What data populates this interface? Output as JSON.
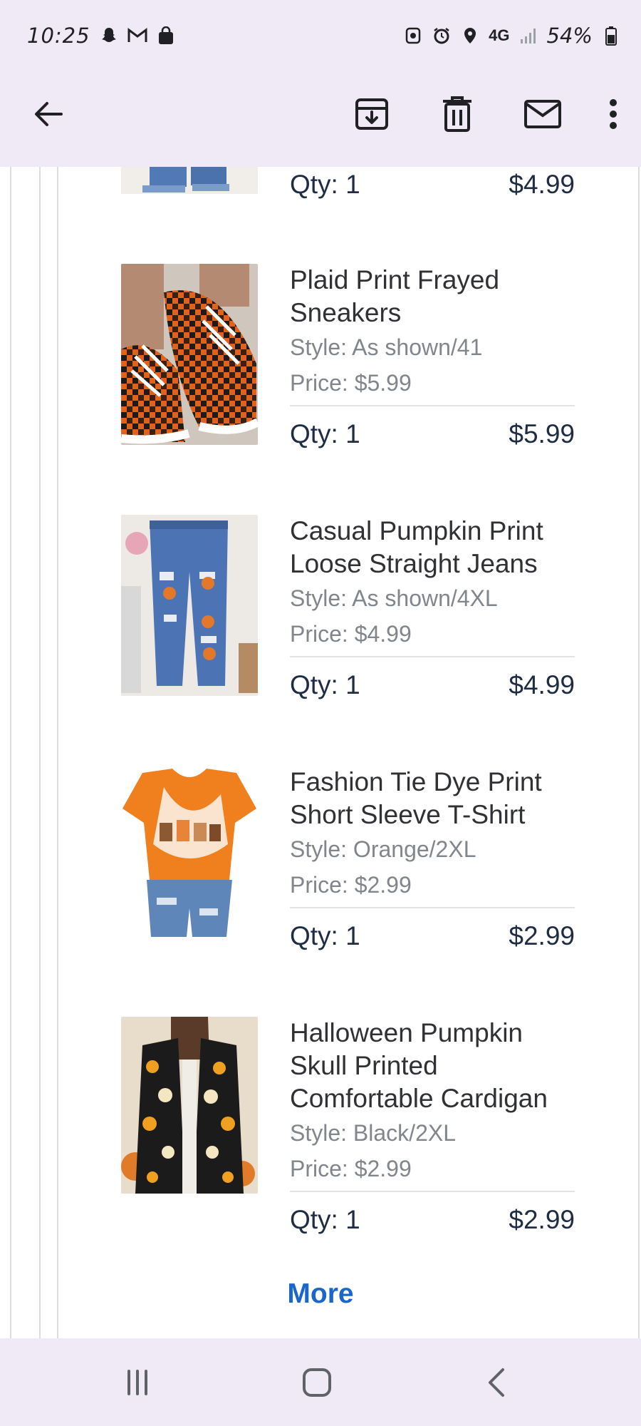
{
  "status_bar": {
    "time": "10:25",
    "network": "4G",
    "battery": "54%",
    "left_icons": [
      "snapchat-icon",
      "gmail-icon",
      "shopping-bag-icon"
    ],
    "right_icons": [
      "nfc-icon",
      "alarm-icon",
      "location-icon",
      "signal-icon",
      "battery-icon"
    ]
  },
  "app_bar": {
    "icons": [
      "back-arrow-icon",
      "archive-icon",
      "delete-icon",
      "mark-unread-icon",
      "more-vert-icon"
    ]
  },
  "items": [
    {
      "title": "",
      "style": "",
      "price": "",
      "qty": "Qty: 1",
      "total": "$4.99",
      "image": "jeans-partial-thumbnail"
    },
    {
      "title": "Plaid Print Frayed Sneakers",
      "style": "Style: As shown/41",
      "price": "Price: $5.99",
      "qty": "Qty: 1",
      "total": "$5.99",
      "image": "orange-plaid-sneakers"
    },
    {
      "title": "Casual Pumpkin Print Loose Straight Jeans",
      "style": "Style: As shown/4XL",
      "price": "Price: $4.99",
      "qty": "Qty: 1",
      "total": "$4.99",
      "image": "pumpkin-patch-jeans"
    },
    {
      "title": "Fashion Tie Dye Print Short Sleeve T-Shirt",
      "style": "Style: Orange/2XL",
      "price": "Price: $2.99",
      "qty": "Qty: 1",
      "total": "$2.99",
      "image": "orange-tie-dye-tshirt"
    },
    {
      "title": "Halloween Pumpkin Skull Printed Comfortable Cardigan",
      "style": "Style: Black/2XL",
      "price": "Price: $2.99",
      "qty": "Qty: 1",
      "total": "$2.99",
      "image": "black-pumpkin-cardigan"
    }
  ],
  "more_link": "More",
  "nav_bar": {
    "icons": [
      "recent-apps-icon",
      "home-icon",
      "back-icon"
    ]
  },
  "colors": {
    "chrome_bg": "#efeaf5",
    "link": "#1a67c9",
    "text_dark": "#1f2d44",
    "text_muted": "#80868b"
  }
}
